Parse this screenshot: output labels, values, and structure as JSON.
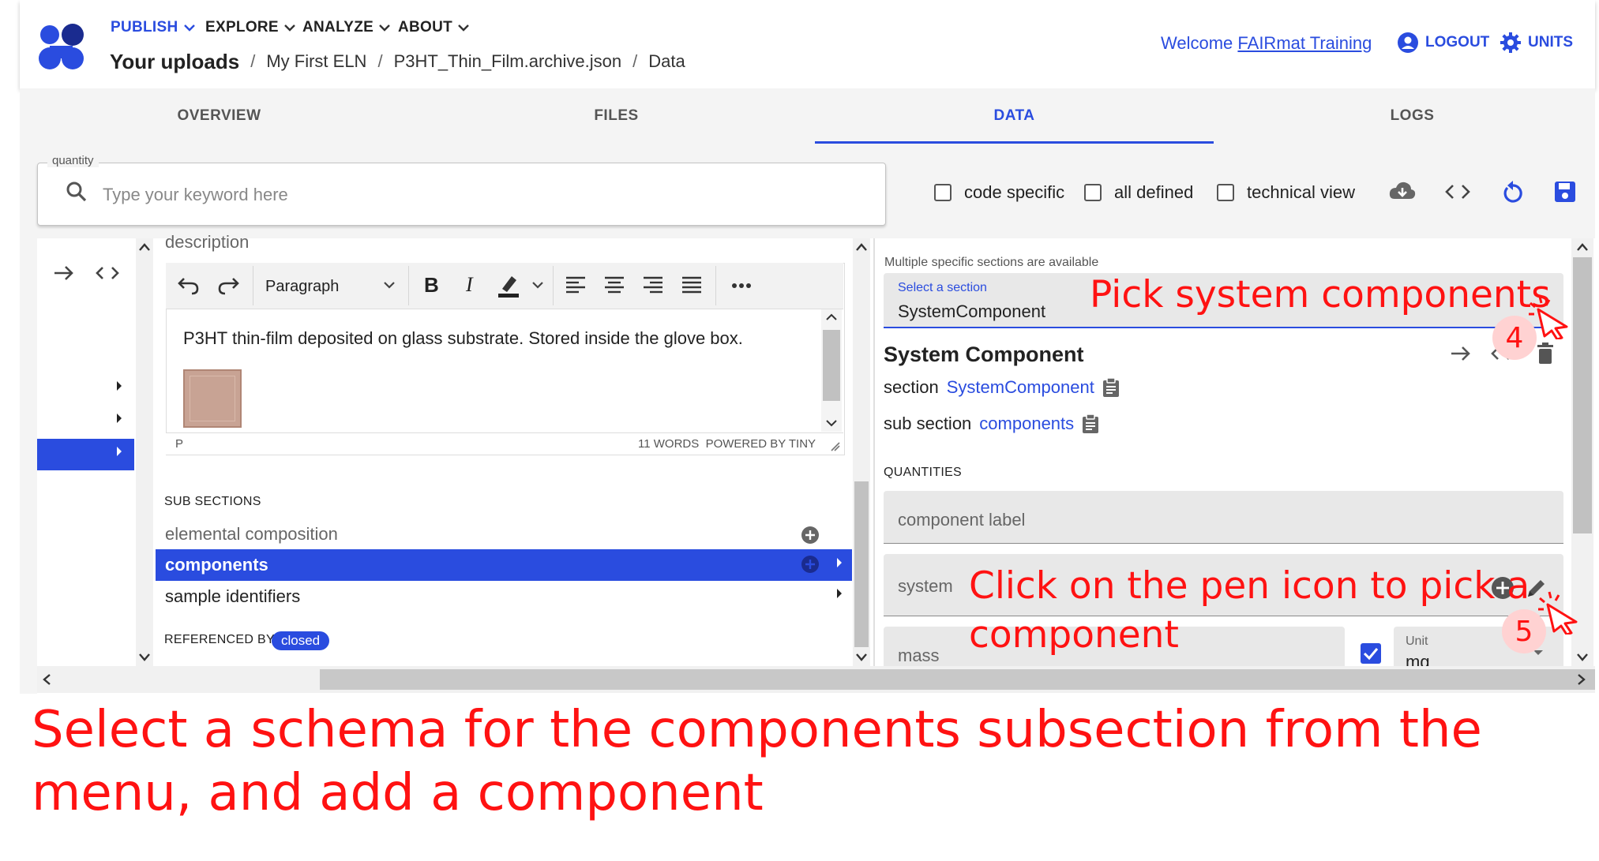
{
  "nav": {
    "menu": [
      {
        "label": "PUBLISH",
        "active": true
      },
      {
        "label": "EXPLORE",
        "active": false
      },
      {
        "label": "ANALYZE",
        "active": false
      },
      {
        "label": "ABOUT",
        "active": false
      }
    ],
    "breadcrumb": [
      "Your uploads",
      "My First ELN",
      "P3HT_Thin_Film.archive.json",
      "Data"
    ],
    "breadcrumb_separator": "/",
    "welcome_prefix": "Welcome",
    "welcome_user": "FAIRmat Training",
    "logout_label": "LOGOUT",
    "units_label": "UNITS"
  },
  "tabs": [
    "OVERVIEW",
    "FILES",
    "DATA",
    "LOGS"
  ],
  "active_tab": "DATA",
  "search": {
    "legend": "quantity",
    "placeholder": "Type your keyword here"
  },
  "filters": [
    {
      "label": "code specific",
      "checked": false
    },
    {
      "label": "all defined",
      "checked": false
    },
    {
      "label": "technical view",
      "checked": false
    }
  ],
  "toolbar_icons": [
    "cloud-download-icon",
    "code-icon",
    "reload-icon",
    "save-icon"
  ],
  "left_panel": {
    "description_label": "description",
    "editor": {
      "block_format": "Paragraph",
      "text": "P3HT thin-film deposited on glass substrate. Stored inside the glove box.",
      "status_left": "P",
      "status_right": "11 WORDS  POWERED BY TINY"
    },
    "sub_sections_heading": "SUB SECTIONS",
    "sub_sections": [
      {
        "label": "elemental composition",
        "selected": false
      },
      {
        "label": "components",
        "selected": true
      },
      {
        "label": "sample identifiers",
        "selected": false
      }
    ],
    "referenced_by_label": "REFERENCED BY",
    "referenced_by_badge": "closed"
  },
  "right_panel": {
    "multi_label": "Multiple specific sections are available",
    "select_label": "Select a section",
    "select_value": "SystemComponent",
    "section_title": "System Component",
    "section_prefix": "section",
    "section_link": "SystemComponent",
    "sub_section_prefix": "sub section",
    "sub_section_link": "components",
    "quantities_heading": "QUANTITIES",
    "fields": {
      "component_label": "component label",
      "system": "system",
      "mass": "mass",
      "unit_label": "Unit",
      "unit_value": "mg"
    }
  },
  "annotations": {
    "pick": "Pick system components",
    "step4": "4",
    "pen": "Click on the pen icon to pick a component",
    "step5": "5",
    "caption": "Select a schema for the components subsection from the menu, and add a component"
  },
  "colors": {
    "accent": "#2a4cdf",
    "annotation": "#ff1212",
    "selected_row": "#2a4cdf"
  }
}
